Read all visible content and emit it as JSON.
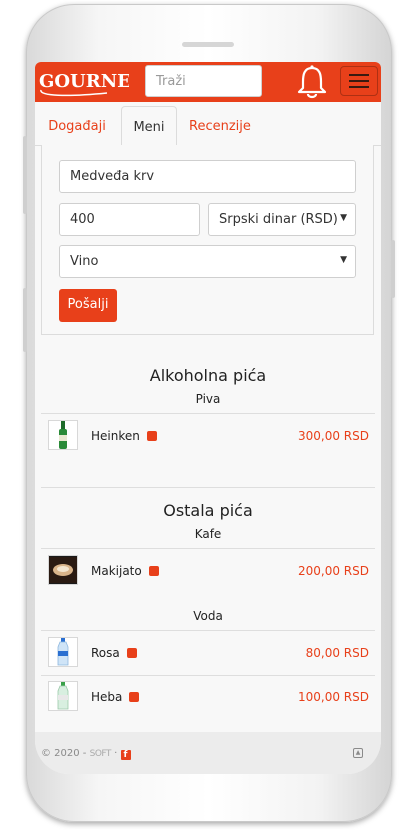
{
  "brand": {
    "logo_text": "GOURNET",
    "accent_color": "#e8401a"
  },
  "navbar": {
    "search_placeholder": "Traži"
  },
  "tabs": [
    {
      "label": "Događaji",
      "active": false
    },
    {
      "label": "Meni",
      "active": true
    },
    {
      "label": "Recenzije",
      "active": false
    }
  ],
  "form": {
    "name_value": "Medveđa krv",
    "price_value": "400",
    "currency_selected": "Srpski dinar (RSD)",
    "category_selected": "Vino",
    "submit_label": "Pošalji"
  },
  "menu": {
    "sections": [
      {
        "title": "Alkoholna pića",
        "groups": [
          {
            "title": "Piva",
            "items": [
              {
                "name": "Heinken",
                "price": "300,00 RSD",
                "icon": "beer-bottle-icon"
              }
            ]
          }
        ]
      },
      {
        "title": "Ostala pića",
        "groups": [
          {
            "title": "Kafe",
            "items": [
              {
                "name": "Makijato",
                "price": "200,00 RSD",
                "icon": "coffee-cup-icon"
              }
            ]
          },
          {
            "title": "Voda",
            "items": [
              {
                "name": "Rosa",
                "price": "80,00 RSD",
                "icon": "water-bottle-icon"
              },
              {
                "name": "Heba",
                "price": "100,00 RSD",
                "icon": "water-bottle-icon"
              }
            ]
          }
        ]
      }
    ]
  },
  "footer": {
    "copyright": "© 2020 -",
    "company": "SOFT",
    "separator": "·",
    "social_icon": "facebook-icon"
  }
}
